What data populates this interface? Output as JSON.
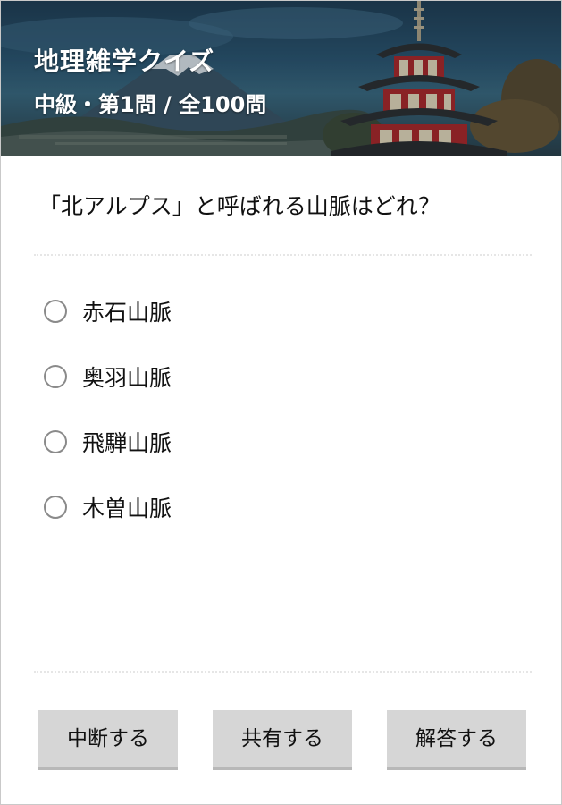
{
  "header": {
    "title": "地理雑学クイズ",
    "subtitle": "中級・第1問 / 全100問"
  },
  "question": {
    "text": "「北アルプス」と呼ばれる山脈はどれ？"
  },
  "options": [
    {
      "label": "赤石山脈",
      "selected": false
    },
    {
      "label": "奥羽山脈",
      "selected": false
    },
    {
      "label": "飛騨山脈",
      "selected": false
    },
    {
      "label": "木曽山脈",
      "selected": false
    }
  ],
  "buttons": {
    "suspend_label": "中断する",
    "share_label": "共有する",
    "answer_label": "解答する"
  },
  "colors": {
    "button_bg": "#d6d6d6",
    "pagoda_red": "#b32424",
    "radio_border": "#8a8a8a"
  },
  "header_image": {
    "icon": "mount-fuji-pagoda-scene"
  }
}
